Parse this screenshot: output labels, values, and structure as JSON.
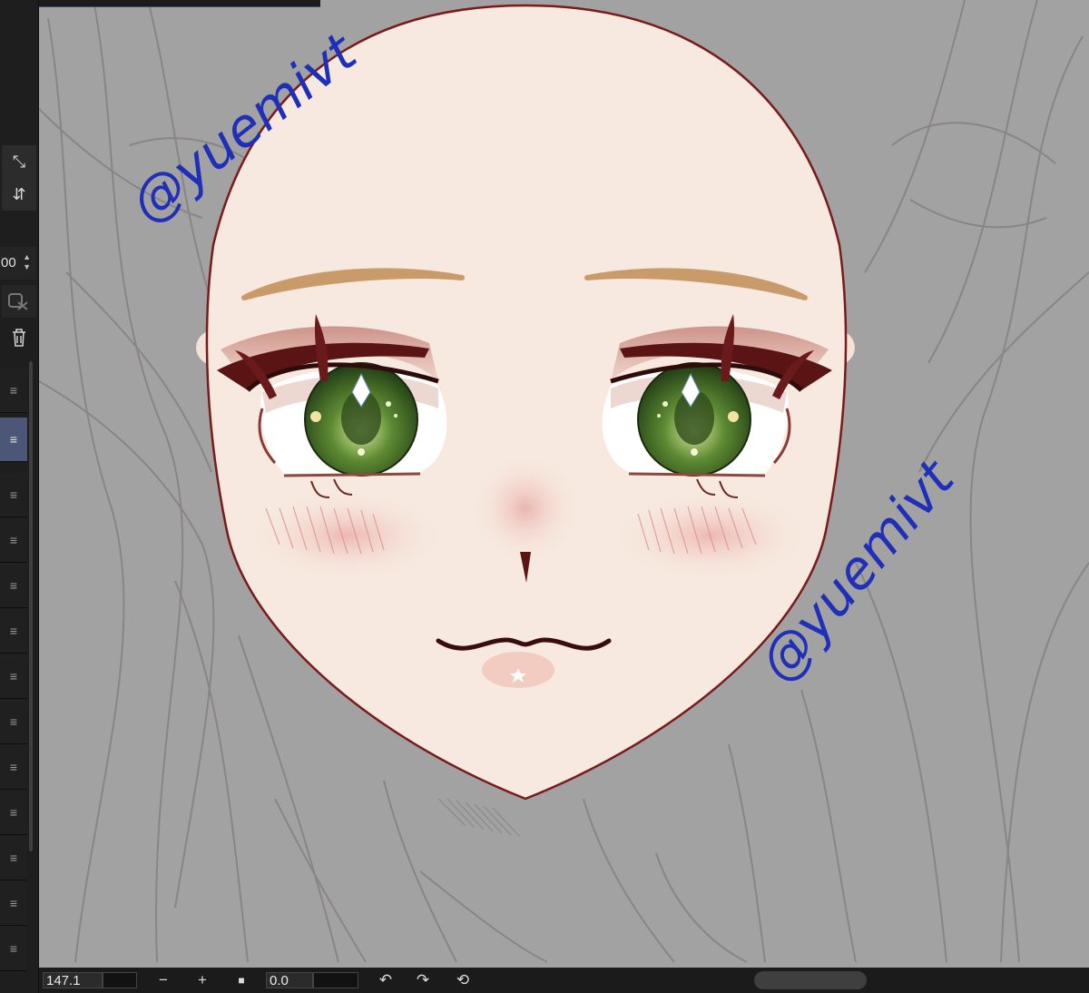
{
  "sidebar": {
    "tools": [
      {
        "name": "transform-icon",
        "glyph": "⤡"
      },
      {
        "name": "flip-vertical-icon",
        "glyph": "⇵"
      }
    ],
    "value_text": "00",
    "delete_icon": "trash-icon",
    "layer_handle_glyph": "≡"
  },
  "canvas": {
    "watermark_1": "@yuemivt",
    "watermark_2": "@yuemivt",
    "background": "#a2a2a2",
    "skin": "#f7e9df",
    "outline": "#7a1a1a",
    "iris": "#3d6b2a"
  },
  "bottom_bar": {
    "zoom_value": "147.1",
    "zoom_out_glyph": "−",
    "zoom_in_glyph": "+",
    "stop_glyph": "■",
    "rotation_value": "0.0",
    "rotate_left_glyph": "↶",
    "rotate_right_glyph": "↷",
    "reset_glyph": "⟲"
  }
}
